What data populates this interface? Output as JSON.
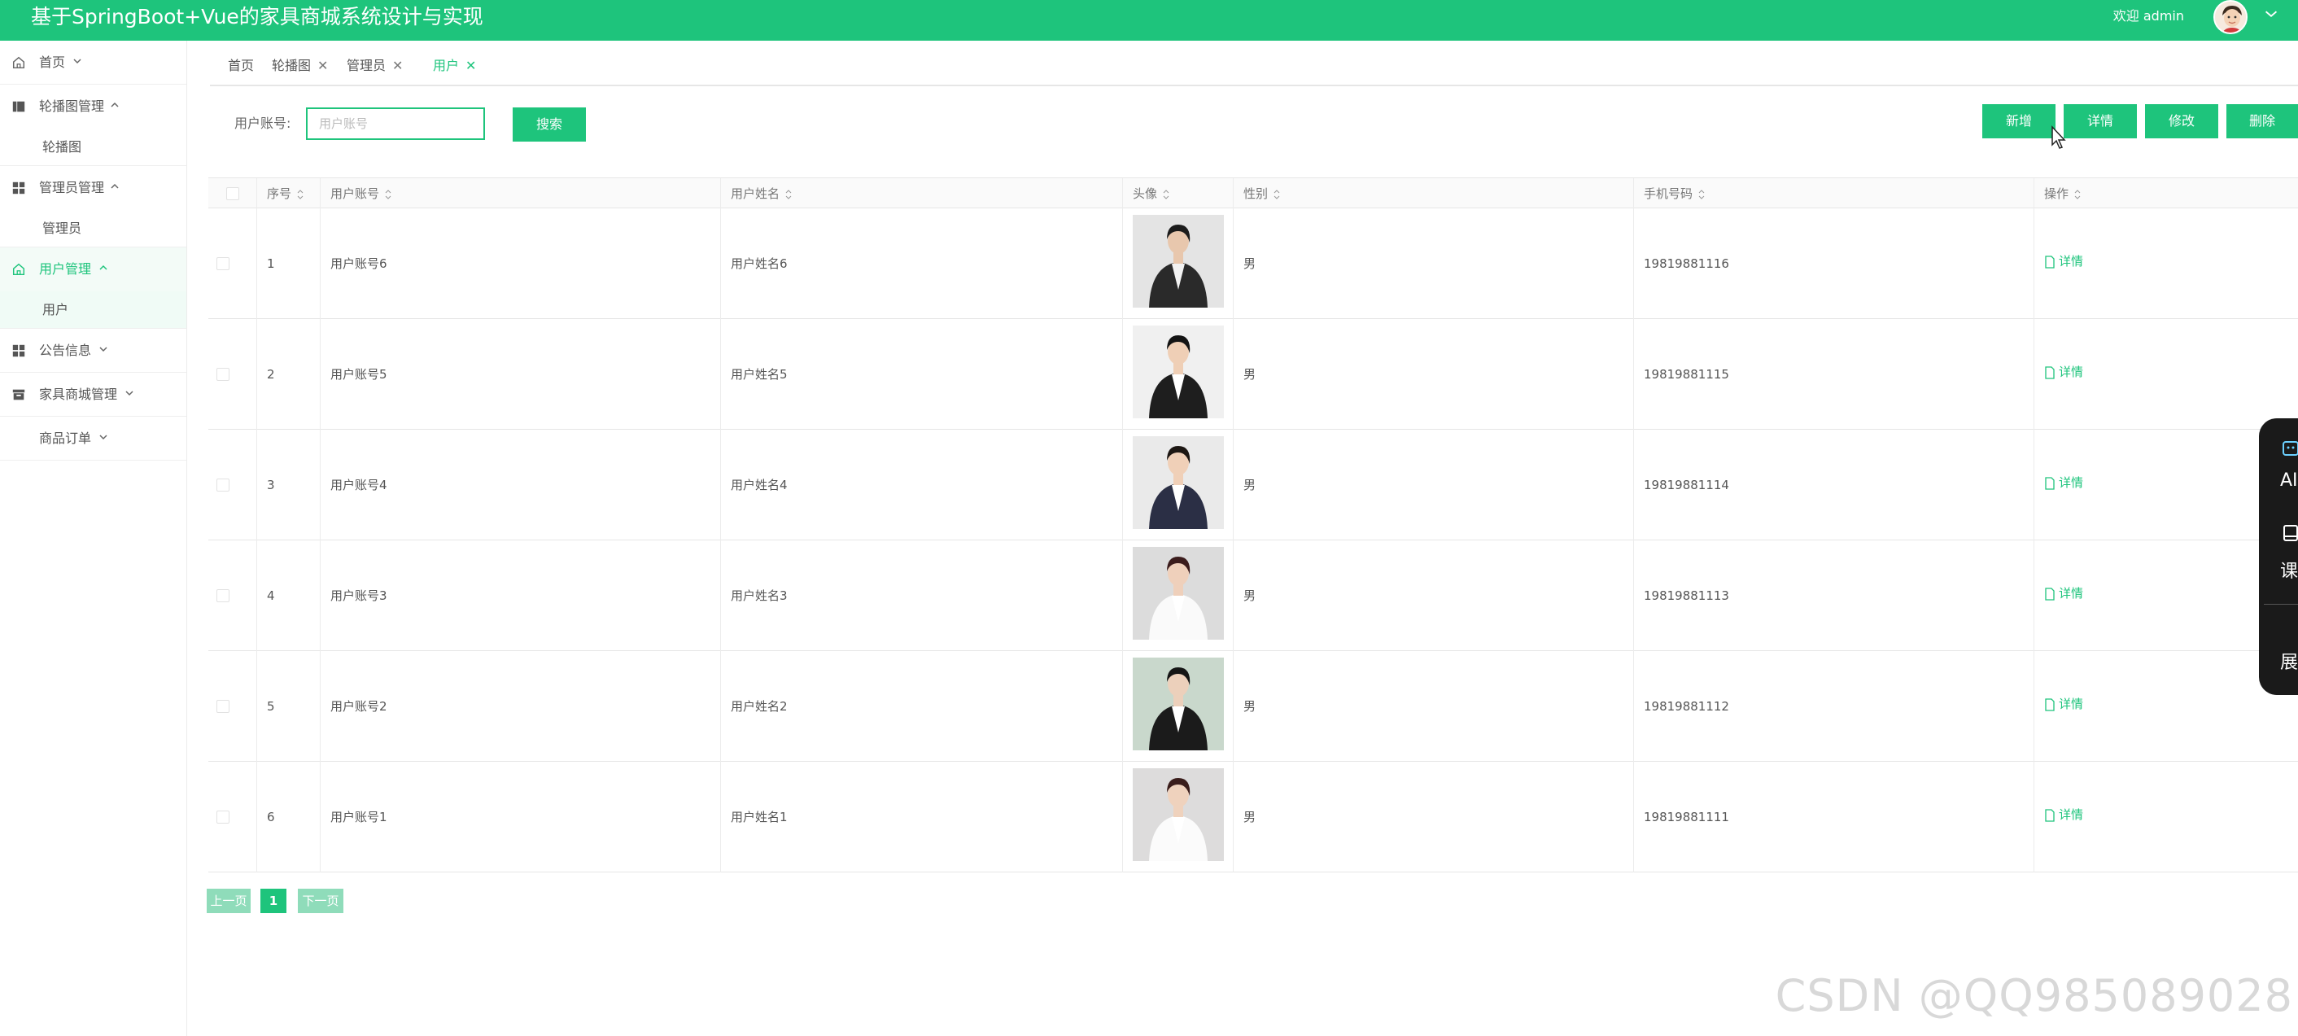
{
  "header": {
    "title": "基于SpringBoot+Vue的家具商城系统设计与实现",
    "welcome": "欢迎 admin"
  },
  "sidebar": {
    "items": [
      {
        "label": "首页"
      },
      {
        "label": "轮播图管理",
        "sub": "轮播图"
      },
      {
        "label": "管理员管理",
        "sub": "管理员"
      },
      {
        "label": "用户管理",
        "sub": "用户"
      },
      {
        "label": "公告信息"
      },
      {
        "label": "家具商城管理"
      },
      {
        "label": "商品订单"
      }
    ]
  },
  "tabs": [
    {
      "label": "首页"
    },
    {
      "label": "轮播图"
    },
    {
      "label": "管理员"
    },
    {
      "label": "用户"
    }
  ],
  "search": {
    "label": "用户账号:",
    "placeholder": "用户账号",
    "button": "搜索"
  },
  "toolbar": {
    "add": "新增",
    "detail": "详情",
    "edit": "修改",
    "delete": "删除"
  },
  "table": {
    "columns": [
      "序号",
      "用户账号",
      "用户姓名",
      "头像",
      "性别",
      "手机号码",
      "操作"
    ],
    "rows": [
      {
        "idx": "1",
        "account": "用户账号6",
        "name": "用户姓名6",
        "gender": "男",
        "phone": "19819881116",
        "action": "详情"
      },
      {
        "idx": "2",
        "account": "用户账号5",
        "name": "用户姓名5",
        "gender": "男",
        "phone": "19819881115",
        "action": "详情"
      },
      {
        "idx": "3",
        "account": "用户账号4",
        "name": "用户姓名4",
        "gender": "男",
        "phone": "19819881114",
        "action": "详情"
      },
      {
        "idx": "4",
        "account": "用户账号3",
        "name": "用户姓名3",
        "gender": "男",
        "phone": "19819881113",
        "action": "详情"
      },
      {
        "idx": "5",
        "account": "用户账号2",
        "name": "用户姓名2",
        "gender": "男",
        "phone": "19819881112",
        "action": "详情"
      },
      {
        "idx": "6",
        "account": "用户账号1",
        "name": "用户姓名1",
        "gender": "男",
        "phone": "19819881111",
        "action": "详情"
      }
    ]
  },
  "pagination": {
    "prev": "上一页",
    "current": "1",
    "next": "下一页"
  },
  "float_panel": {
    "items": [
      "AI",
      "课",
      "展"
    ]
  },
  "watermark": "CSDN @QQ985089028",
  "colors": {
    "primary": "#1ec47c",
    "header_text": "#ffffff",
    "float_panel": "#1a1a1a"
  }
}
